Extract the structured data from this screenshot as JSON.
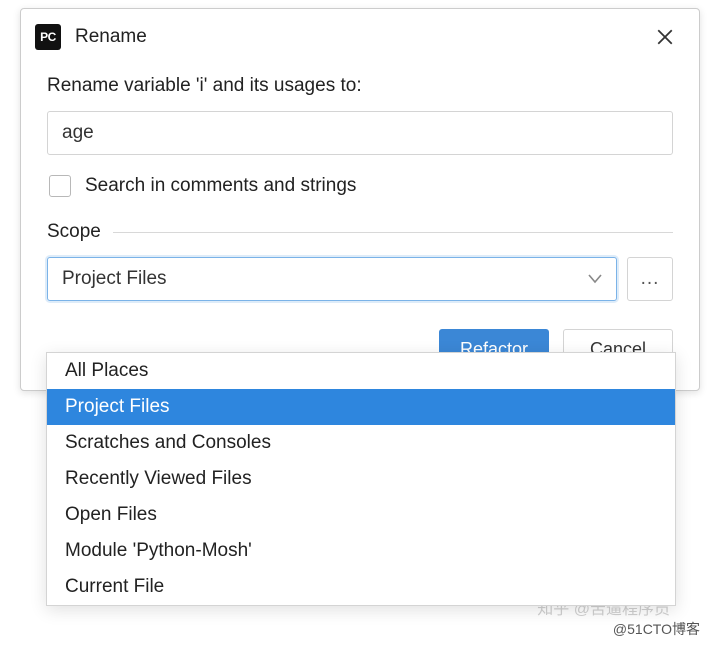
{
  "dialog": {
    "app_icon_text": "PC",
    "title": "Rename",
    "prompt": "Rename variable 'i' and its usages to:",
    "input_value": "age",
    "checkbox_label": "Search in comments and strings",
    "scope_label": "Scope",
    "dropdown_selected": "Project Files",
    "more_btn": "...",
    "options": [
      {
        "label": "All Places",
        "selected": false
      },
      {
        "label": "Project Files",
        "selected": true
      },
      {
        "label": "Scratches and Consoles",
        "selected": false
      },
      {
        "label": "Recently Viewed Files",
        "selected": false
      },
      {
        "label": "Open Files",
        "selected": false
      },
      {
        "label": "Module 'Python-Mosh'",
        "selected": false
      },
      {
        "label": "Current File",
        "selected": false
      }
    ],
    "refactor_label": "Refactor",
    "cancel_label": "Cancel",
    "cancel_visible_fragment": "el"
  },
  "watermarks": {
    "zhihu": "知乎 @苦逼程序员",
    "cto": "@51CTO博客"
  }
}
